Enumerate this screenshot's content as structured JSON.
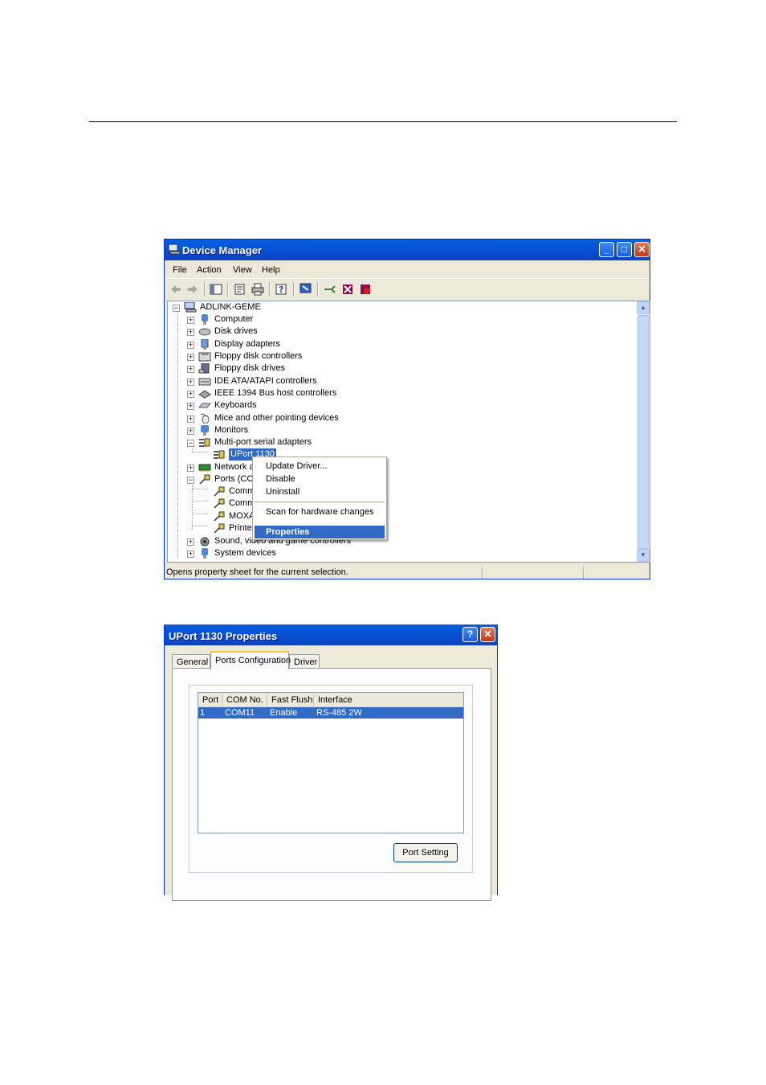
{
  "device_manager": {
    "title": "Device Manager",
    "window_buttons": {
      "minimize": "_",
      "maximize": "□",
      "close": "✕"
    },
    "menu": [
      "File",
      "Action",
      "View",
      "Help"
    ],
    "tree": {
      "root": "ADLINK-GEME",
      "items": [
        {
          "label": "Computer",
          "icon": "computer-icon"
        },
        {
          "label": "Disk drives",
          "icon": "disk-drive-icon"
        },
        {
          "label": "Display adapters",
          "icon": "display-adapter-icon"
        },
        {
          "label": "Floppy disk controllers",
          "icon": "floppy-controller-icon"
        },
        {
          "label": "Floppy disk drives",
          "icon": "floppy-drive-icon"
        },
        {
          "label": "IDE ATA/ATAPI controllers",
          "icon": "ide-controller-icon"
        },
        {
          "label": "IEEE 1394 Bus host controllers",
          "icon": "ieee1394-icon"
        },
        {
          "label": "Keyboards",
          "icon": "keyboard-icon"
        },
        {
          "label": "Mice and other pointing devices",
          "icon": "mouse-icon"
        },
        {
          "label": "Monitors",
          "icon": "monitor-icon"
        },
        {
          "label": "Multi-port serial adapters",
          "icon": "serial-adapter-icon"
        },
        {
          "label": "UPort 1130",
          "icon": "serial-adapter-icon"
        },
        {
          "label": "Network ac",
          "icon": "network-adapter-icon"
        },
        {
          "label": "Ports (COM",
          "icon": "port-icon"
        },
        {
          "label": "Commu",
          "icon": "port-icon"
        },
        {
          "label": "Commu",
          "icon": "port-icon"
        },
        {
          "label": "MOXA",
          "icon": "port-icon"
        },
        {
          "label": "Printer",
          "icon": "port-icon"
        },
        {
          "label": "Sound, video and game controllers",
          "icon": "sound-icon"
        },
        {
          "label": "System devices",
          "icon": "system-device-icon"
        }
      ]
    },
    "context_menu": {
      "items": [
        "Update Driver...",
        "Disable",
        "Uninstall",
        "Scan for hardware changes",
        "Properties"
      ],
      "highlighted": "Properties"
    },
    "status": "Opens property sheet for the current selection."
  },
  "properties_dialog": {
    "title": "UPort 1130 Properties",
    "window_buttons": {
      "help": "?",
      "close": "✕"
    },
    "tabs": [
      "General",
      "Ports Configuration",
      "Driver"
    ],
    "active_tab": "Ports Configuration",
    "columns": [
      "Port",
      "COM No.",
      "Fast Flush",
      "Interface"
    ],
    "rows": [
      {
        "port": "1",
        "com": "COM11",
        "fast_flush": "Enable",
        "interface": "RS-485 2W"
      }
    ],
    "port_setting_button": "Port Setting"
  },
  "colors": {
    "title_blue": "#0453d8",
    "selection": "#316ac5",
    "dialog_bg": "#ece9d8"
  }
}
